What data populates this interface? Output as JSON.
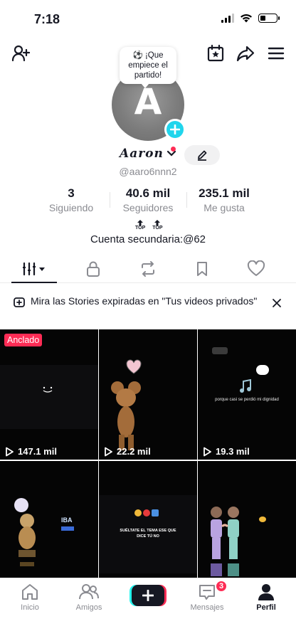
{
  "status_bar": {
    "time": "7:18"
  },
  "colors": {
    "accent": "#fe2c55",
    "cyan": "#20d5ec",
    "muted": "#8a8b91",
    "text": "#161823"
  },
  "header_icons": [
    "add-friend-icon",
    "calendar-star-icon",
    "share-icon",
    "menu-icon"
  ],
  "profile": {
    "avatar_letter": "A",
    "bubble_text": "⚽ ¡Que empiece el partido!",
    "display_name": "Aaron",
    "username": "@aaro6nnn2",
    "secondary_account": "Cuenta secundaria:@62"
  },
  "stats": [
    {
      "value": "3",
      "label": "Siguiendo"
    },
    {
      "value": "40.6 mil",
      "label": "Seguidores"
    },
    {
      "value": "235.1 mil",
      "label": "Me gusta"
    }
  ],
  "top_badges": [
    "TOP",
    "TOP"
  ],
  "tabs": [
    "videos-icon",
    "lock-icon",
    "repost-icon",
    "bookmark-icon",
    "heart-icon"
  ],
  "banner": {
    "text": "Mira las Stories expiradas en \"Tus videos privados\""
  },
  "videos": [
    {
      "views": "147.1 mil",
      "pinned": "Anclado"
    },
    {
      "views": "22.2 mil"
    },
    {
      "views": "19.3 mil"
    },
    {
      "caption": "IBA"
    },
    {
      "caption": "SUÉLTATE EL TEMA ESE QUE DICE TÚ NO"
    },
    {
      "caption": ""
    }
  ],
  "video_overlay_texts": [
    "porque casi se perdió mi dignidad"
  ],
  "bottom_nav": {
    "items": [
      "Inicio",
      "Amigos",
      "",
      "Mensajes",
      "Perfil"
    ],
    "message_badge": "3"
  }
}
